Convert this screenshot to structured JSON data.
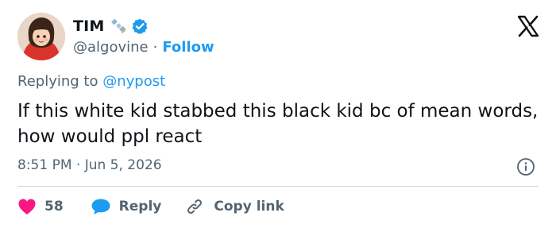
{
  "user": {
    "display_name": "TIM",
    "handle": "@algovine",
    "separator": "·",
    "follow_label": "Follow"
  },
  "reply": {
    "prefix": "Replying to ",
    "mention": "@nypost"
  },
  "tweet": {
    "text": "If this white kid stabbed this black kid bc of mean words, how would ppl react",
    "time": "8:51 PM",
    "separator": " · ",
    "date": "Jun 5, 2026"
  },
  "actions": {
    "like_count": "58",
    "reply_label": "Reply",
    "copy_label": "Copy link"
  },
  "colors": {
    "accent": "#1d9bf0",
    "like": "#f91880",
    "secondary_text": "#536471"
  },
  "icons": [
    "satellite-icon",
    "verified-badge-icon",
    "x-logo-icon",
    "info-icon",
    "heart-icon",
    "reply-bubble-icon",
    "link-icon"
  ]
}
